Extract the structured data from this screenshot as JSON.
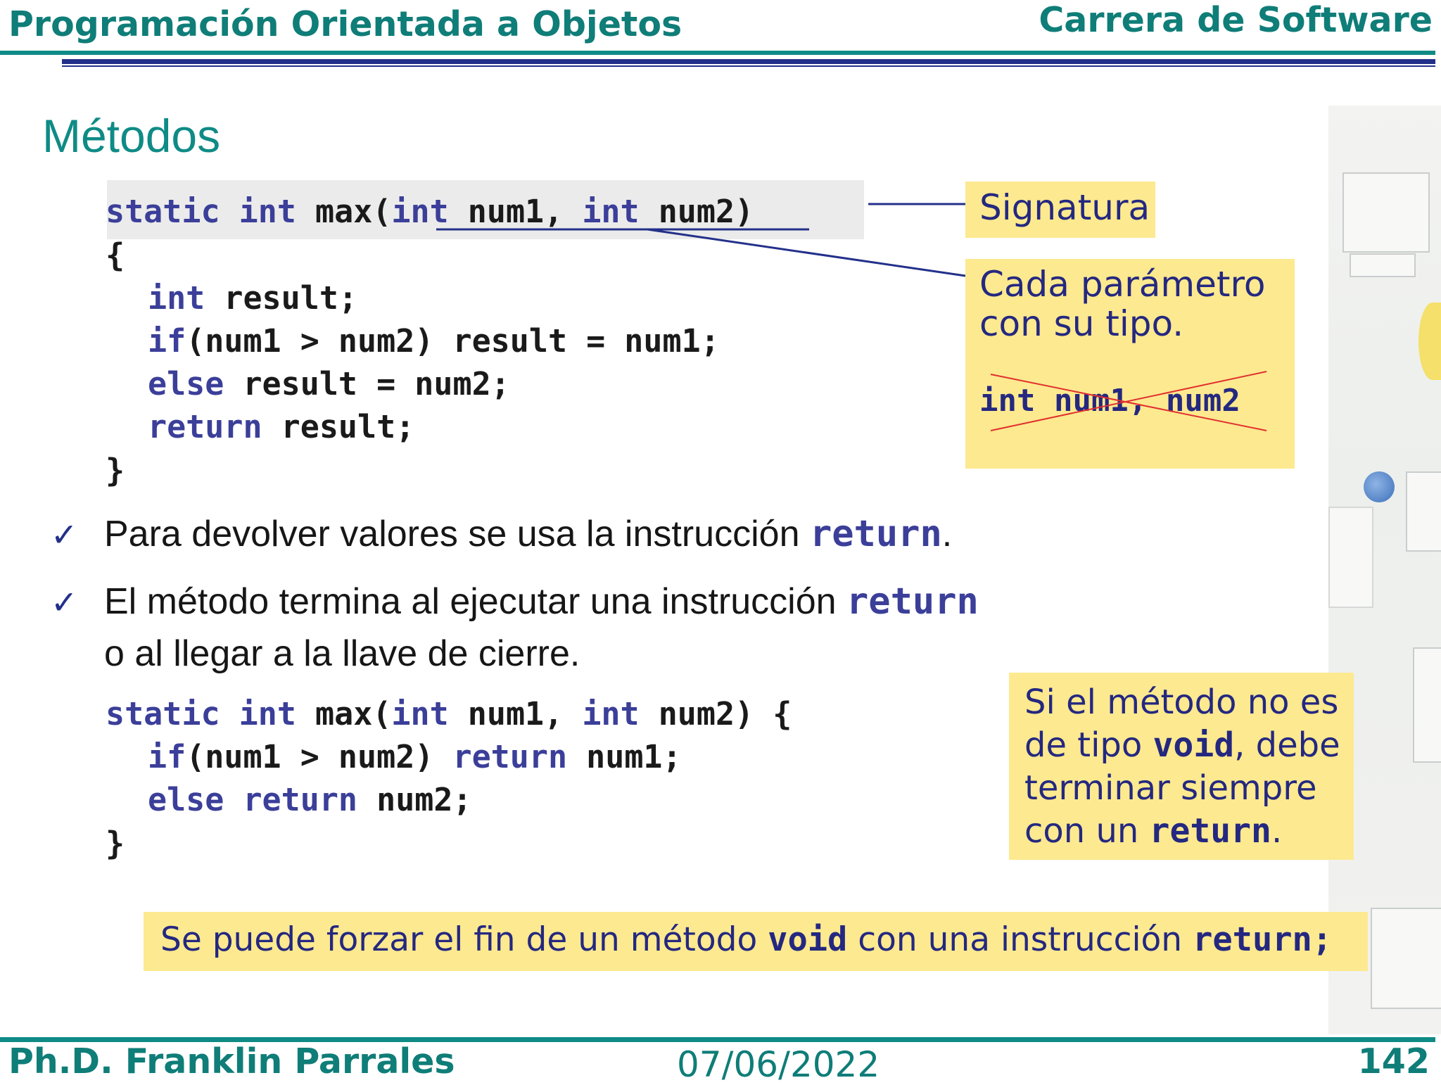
{
  "header": {
    "course": "Programación Orientada a Objetos",
    "program": "Carrera de Software"
  },
  "title": "Métodos",
  "code_block_1": {
    "signature": {
      "kw_static": "static",
      "kw_int": "int",
      "name": "max(",
      "p1_type": "int",
      "p1_name": "num1,",
      "p2_type": "int",
      "p2_name": "num2)"
    },
    "open_brace": "{",
    "line1": {
      "kw": "int",
      "rest": "result;"
    },
    "line2": {
      "kw": "if",
      "rest": "(num1 > num2) result = num1;"
    },
    "line3": {
      "kw": "else",
      "rest": "result = num2;"
    },
    "line4": {
      "kw": "return",
      "rest": "result;"
    },
    "close_brace": "}"
  },
  "callouts": {
    "signatura": "Signatura",
    "param_line1": "Cada parámetro",
    "param_line2": "con su tipo.",
    "crossed_code": "int num1, num2",
    "nonvoid_line1": "Si el método no es",
    "nonvoid_line2_pre": "de tipo",
    "nonvoid_line2_code": "void",
    "nonvoid_line2_post": ", debe",
    "nonvoid_line3": "terminar siempre",
    "nonvoid_line4_pre": "con un",
    "nonvoid_line4_code": "return",
    "nonvoid_line4_post": ".",
    "void_pre": "Se puede forzar el fin de un método",
    "void_code1": "void",
    "void_mid": "con una instrucción",
    "void_code2": "return;"
  },
  "bullets": [
    {
      "text": "Para devolver valores se usa la instrucción",
      "code": "return",
      "after": "."
    },
    {
      "text": "El método termina al ejecutar una instrucción",
      "code": "return",
      "line2": "o al llegar a la llave de cierre."
    }
  ],
  "code_block_2": {
    "line1": {
      "kw_static": "static",
      "kw_int": "int",
      "name": "max(",
      "p1_type": "int",
      "p1_name": "num1,",
      "p2_type": "int",
      "p2_name": "num2) {"
    },
    "line2": {
      "kw_if": "if",
      "mid": "(num1 > num2) ",
      "kw_return": "return",
      "rest": " num1;"
    },
    "line3": {
      "kw_else": "else",
      "kw_return": "return",
      "rest": " num2;"
    },
    "close_brace": "}"
  },
  "footer": {
    "author": "Ph.D. Franklin Parrales",
    "date": "07/06/2022",
    "page": "142"
  },
  "colors": {
    "teal": "#0f8b86",
    "navy": "#23308a",
    "keyword": "#3b3f99",
    "note_bg": "#fde98f",
    "strike_red": "#e03030"
  }
}
